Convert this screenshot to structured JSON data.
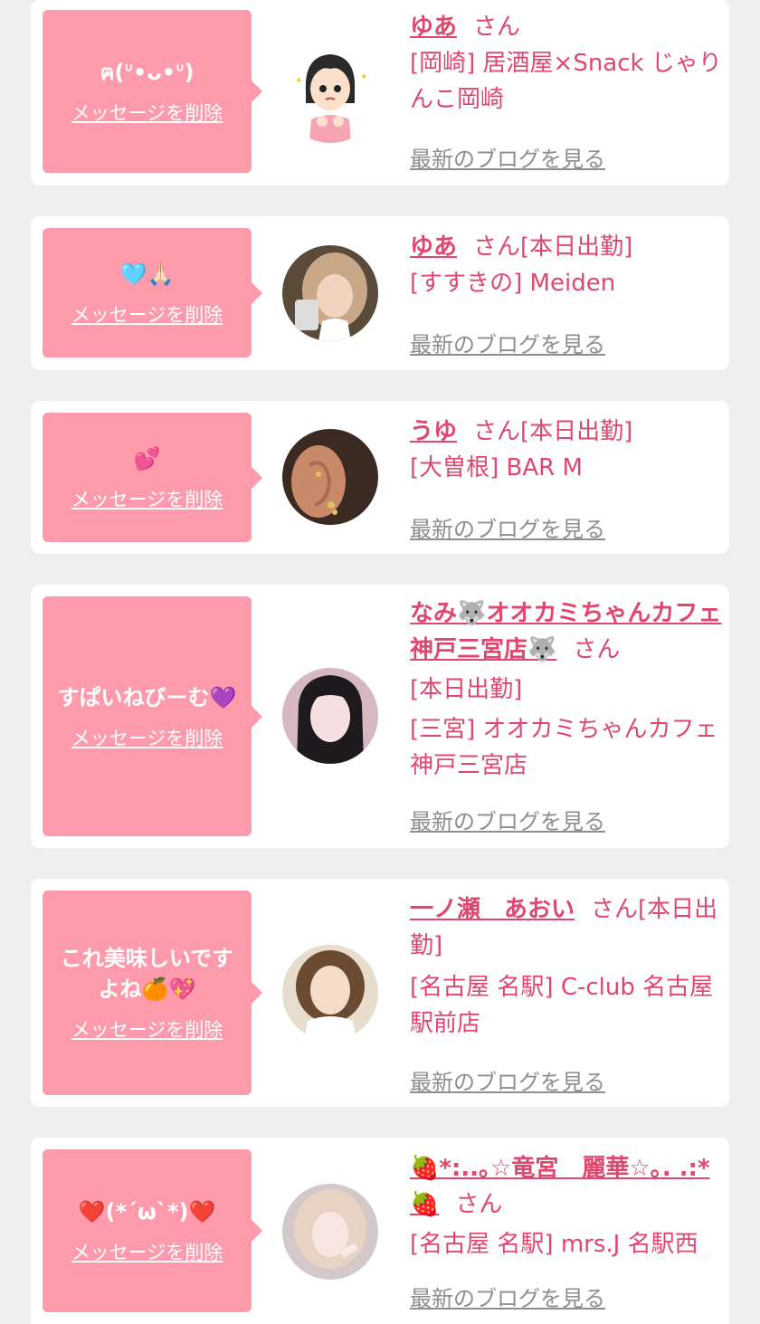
{
  "delete_label": "メッセージを削除",
  "san_label": "さん",
  "blog_label": "最新のブログを見る",
  "colors": {
    "accent": "#e0476f",
    "bubble": "#fd9aac",
    "background": "#efefef"
  },
  "entries": [
    {
      "message": "ฅ(ᐡ•ᴗ•ᐡ)",
      "name": "ゆあ",
      "status": "",
      "shop": "[岡崎] 居酒屋×Snack じゃりんこ岡崎",
      "avatar": "illustration-girl-avatar"
    },
    {
      "message": "🩵🙏🏻",
      "name": "ゆあ",
      "status": "[本日出勤]",
      "shop": "[すすきの] Meiden",
      "avatar": "photo-avatar"
    },
    {
      "message": "💕",
      "name": "うゆ",
      "status": "[本日出勤]",
      "shop": "[大曽根] BAR M",
      "avatar": "ear-photo-avatar"
    },
    {
      "message": "すぱいねびーむ💜",
      "name": "なみ🐺オオカミちゃんカフェ神戸三宮店🐺",
      "status": "[本日出勤]",
      "shop": "[三宮] オオカミちゃんカフェ神戸三宮店",
      "avatar": "photo-avatar"
    },
    {
      "message": "これ美味しいですよね🍊💖",
      "name": "一ノ瀬　あおい",
      "status": "[本日出勤]",
      "shop": "[名古屋 名駅] C-club 名古屋駅前店",
      "avatar": "photo-avatar"
    },
    {
      "message": "❤️(*´ω`*)❤️",
      "name": "🍓*:..｡☆竜宮　麗華☆｡. .:*🍓",
      "status": "",
      "shop": "[名古屋 名駅] mrs.J 名駅西",
      "avatar": "photo-avatar"
    }
  ]
}
